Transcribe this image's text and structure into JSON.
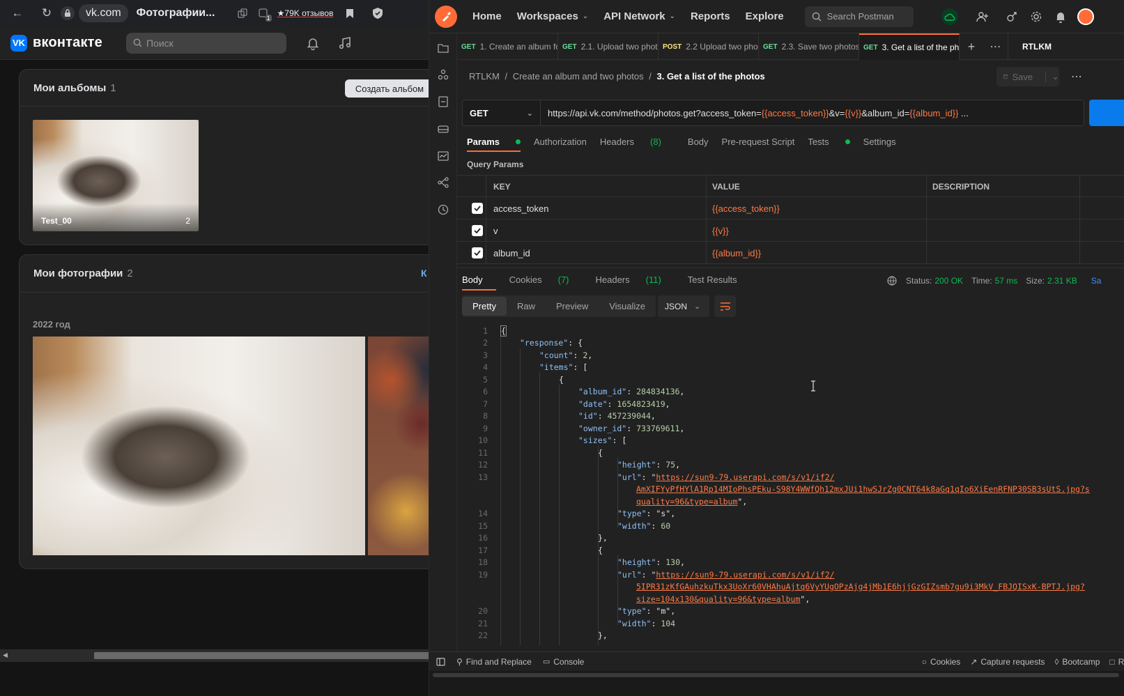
{
  "browser": {
    "domain": "vk.com",
    "tab_title": "Фотографии...",
    "reviews": "★79K отзывов",
    "badge": "1"
  },
  "vk": {
    "brand": "вконтакте",
    "search_placeholder": "Поиск",
    "albums": {
      "title": "Мои альбомы",
      "count": "1",
      "create_label": "Создать альбом",
      "items": [
        {
          "name": "Test_00",
          "count": "2"
        }
      ]
    },
    "photos": {
      "title": "Мои фотографии",
      "count": "2",
      "cut_link": "К",
      "year": "2022 год"
    }
  },
  "postman": {
    "nav": {
      "home": "Home",
      "workspaces": "Workspaces",
      "api_network": "API Network",
      "reports": "Reports",
      "explore": "Explore",
      "search_placeholder": "Search Postman"
    },
    "tabs": [
      {
        "method": "GET",
        "label": "1. Create an album fo"
      },
      {
        "method": "GET",
        "label": "2.1. Upload two phot"
      },
      {
        "method": "POST",
        "label": "2.2 Upload two pho"
      },
      {
        "method": "GET",
        "label": "2.3. Save two photos"
      },
      {
        "method": "GET",
        "label": "3. Get a list of the ph"
      }
    ],
    "environment": "RTLKM",
    "breadcrumb": {
      "root": "RTLKM",
      "folder": "Create an album and two photos",
      "current": "3. Get a list of the photos"
    },
    "save_label": "Save",
    "request": {
      "method": "GET",
      "url_prefix": "https://api.vk.com/method/photos.get?access_token=",
      "url_var1": "{{access_token}}",
      "url_mid1": "&v=",
      "url_var2": "{{v}}",
      "url_mid2": "&album_id=",
      "url_var3": "{{album_id}}",
      "url_suffix": " ..."
    },
    "request_tabs": {
      "params": "Params",
      "authorization": "Authorization",
      "headers": "Headers",
      "headers_count": "(8)",
      "body": "Body",
      "prerequest": "Pre-request Script",
      "tests": "Tests",
      "settings": "Settings"
    },
    "query_params": {
      "title": "Query Params",
      "columns": [
        "KEY",
        "VALUE",
        "DESCRIPTION"
      ],
      "rows": [
        {
          "key": "access_token",
          "value": "{{access_token}}"
        },
        {
          "key": "v",
          "value": "{{v}}"
        },
        {
          "key": "album_id",
          "value": "{{album_id}}"
        }
      ]
    },
    "response_tabs": {
      "body": "Body",
      "cookies": "Cookies",
      "cookies_count": "(7)",
      "headers": "Headers",
      "headers_count": "(11)",
      "test_results": "Test Results"
    },
    "status": {
      "status_label": "Status:",
      "status": "200 OK",
      "time_label": "Time:",
      "time": "57 ms",
      "size_label": "Size:",
      "size": "2.31 KB",
      "save_cut": "Sa"
    },
    "view_modes": [
      "Pretty",
      "Raw",
      "Preview",
      "Visualize"
    ],
    "format": "JSON",
    "code": {
      "url1a": "https://sun9-79.userapi.com/s/v1/if2/",
      "url1b": "AmXIFYyPfHYlA1Rp14MIoPhsPEku-S98Y4WWfQh12mxJUi1hwSJrZg0CNT64k8aGq1qIo6XiEenRFNP30SB3sUtS.jpg?s",
      "url1c": "quality=96&type=album",
      "url2a": "https://sun9-79.userapi.com/s/v1/if2/",
      "url2b": "5IPR31zKfGAuhzkuTkx3UoXr60VHAhuAjtq6VyYUgOPzAjg4jMb1E6hjjGzGIZsmb7gu9i3MkV_FBJQISxK-BPTJ.jpg?",
      "url2c": "size=104x130&quality=96&type=album"
    },
    "footer": {
      "find_replace": "Find and Replace",
      "console": "Console",
      "cookies": "Cookies",
      "capture": "Capture requests",
      "bootcamp": "Bootcamp",
      "runner_cut": "Ru"
    }
  }
}
